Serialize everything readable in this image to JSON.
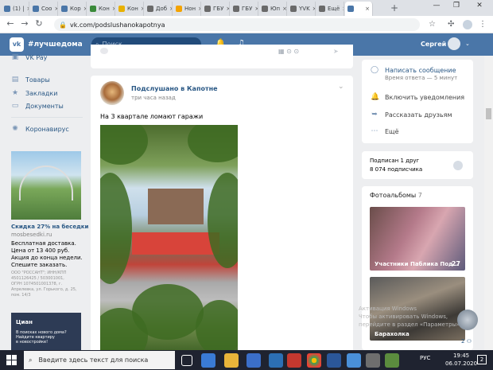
{
  "browser": {
    "tabs": [
      {
        "label": "(1) |",
        "color": "#4a76a8"
      },
      {
        "label": "Соо",
        "color": "#4a76a8"
      },
      {
        "label": "Кор",
        "color": "#4a76a8"
      },
      {
        "label": "Кон",
        "color": "#3a8a3a"
      },
      {
        "label": "Кон",
        "color": "#e8b100"
      },
      {
        "label": "Доб",
        "color": "#6a6a6a"
      },
      {
        "label": "Нон",
        "color": "#f4a300"
      },
      {
        "label": "ГБУ",
        "color": "#6a6a6a"
      },
      {
        "label": "ГБУ",
        "color": "#6a6a6a"
      },
      {
        "label": "Юп",
        "color": "#6a6a6a"
      },
      {
        "label": "YVK",
        "color": "#6a6a6a"
      },
      {
        "label": "Ещё",
        "color": "#6a6a6a"
      },
      {
        "label": "",
        "color": "#4a76a8"
      }
    ],
    "url": "vk.com/podslushanokapotnya",
    "new_tab": "+",
    "minimize": "—",
    "maximize": "❐",
    "close": "✕"
  },
  "vk": {
    "hashtag": "#лучшедома",
    "logo": "vk",
    "search_placeholder": "Поиск",
    "username": "Сергей"
  },
  "left_nav": {
    "vkpay": "VK Pay",
    "items": [
      "Товары",
      "Закладки",
      "Документы"
    ],
    "corona": "Коронавирус"
  },
  "ad1": {
    "title": "Скидка 27% на беседки",
    "domain": "mosbesedki.ru",
    "lines": [
      "Бесплатная доставка.",
      "Цена от 13 400 руб.",
      "Акция до конца недели.",
      "Спешите заказать."
    ],
    "legal": [
      "ООО \"РОССАНТ\"; ИНН/КПП",
      "4501126425 / 503001001,",
      "ОГРН 1074501001378, г.",
      "Апрелевка, ул. Горького, д. 25,",
      "пом. 14/3"
    ]
  },
  "ad2": {
    "logo": "Циан",
    "text": [
      "В поисках нового дома?",
      "Найдите квартиру",
      "в новостройке!"
    ]
  },
  "post": {
    "author": "Подслушано в Капотне",
    "time": "три часа назад",
    "text": "На 3 квартале ломают гаражи"
  },
  "right": {
    "message_label": "Написать сообщение",
    "response_time": "Время ответа — 5 минут",
    "notify": "Включить уведомления",
    "share": "Рассказать друзьям",
    "more": "Ещё",
    "subscribed": "Подписан 1 друг",
    "subscribers": "8 074 подписчика",
    "albums_title": "Фотоальбомы",
    "albums_count": "7",
    "album1_name": "Участники Паблика Под...",
    "album1_count": "27",
    "album2_name": "Барахолка"
  },
  "watermark": {
    "line1": "Активация Windows",
    "line2": "Чтобы активировать Windows,",
    "line3": "перейдите в раздел «Параметры»."
  },
  "taskbar": {
    "search_placeholder": "Введите здесь текст для поиска",
    "lang": "РУС",
    "time": "19:45",
    "date": "06.07.2020",
    "notif_count": "2"
  }
}
